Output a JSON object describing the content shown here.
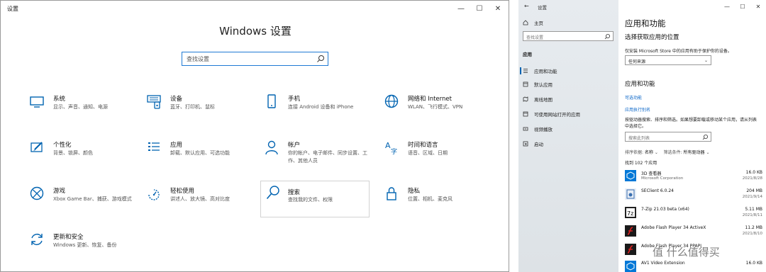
{
  "left": {
    "window_title": "设置",
    "heading": "Windows 设置",
    "search_placeholder": "查找设置",
    "tiles": [
      {
        "title": "系统",
        "desc": "显示、声音、通知、电源"
      },
      {
        "title": "设备",
        "desc": "蓝牙、打印机、鼠标"
      },
      {
        "title": "手机",
        "desc": "连接 Android 设备和 iPhone"
      },
      {
        "title": "网络和 Internet",
        "desc": "WLAN、飞行模式、VPN"
      },
      {
        "title": "个性化",
        "desc": "背景、锁屏、颜色"
      },
      {
        "title": "应用",
        "desc": "卸载、默认应用、可选功能"
      },
      {
        "title": "帐户",
        "desc": "你的帐户、电子邮件、同步设置、工作、其他人员"
      },
      {
        "title": "时间和语言",
        "desc": "语音、区域、日期"
      },
      {
        "title": "游戏",
        "desc": "Xbox Game Bar、捕获、游戏模式"
      },
      {
        "title": "轻松使用",
        "desc": "讲述人、放大镜、高对比度"
      },
      {
        "title": "搜索",
        "desc": "查找我的文件、权限"
      },
      {
        "title": "隐私",
        "desc": "位置、相机、麦克风"
      },
      {
        "title": "更新和安全",
        "desc": "Windows 更新、恢复、备份"
      }
    ],
    "icons": [
      "monitor-icon",
      "keyboard-icon",
      "phone-icon",
      "globe-icon",
      "paintbrush-icon",
      "apps-list-icon",
      "person-icon",
      "language-icon",
      "xbox-icon",
      "ease-of-access-icon",
      "search-icon",
      "lock-icon",
      "refresh-icon"
    ]
  },
  "right": {
    "window_title": "设置",
    "home": "主页",
    "search_placeholder": "查找设置",
    "group": "应用",
    "nav": [
      "应用和功能",
      "默认应用",
      "离线地图",
      "可使用网站打开的应用",
      "视频播放",
      "启动"
    ],
    "title": "应用和功能",
    "section1": "选择获取应用的位置",
    "section1_desc": "仅安装 Microsoft Store 中的应用有助于保护你的设备。",
    "source_value": "任何来源",
    "section2": "应用和功能",
    "link_optional": "可选功能",
    "link_alias": "应用执行别名",
    "para": "按驱动器搜索、排序和筛选。如果想要卸载或移动某个应用，请从列表中选择它。",
    "list_search_placeholder": "搜索此列表",
    "sort_label": "排序依据:",
    "sort_value": "名称",
    "filter_label": "筛选条件:",
    "filter_value": "所有驱动器",
    "found": "找到 102 个应用",
    "apps": [
      {
        "name": "3D 查看器",
        "publisher": "Microsoft Corporation",
        "size": "16.0 KB",
        "date": "2021/8/28"
      },
      {
        "name": "SEClient 6.0.24",
        "publisher": "",
        "size": "204 MB",
        "date": "2021/9/14"
      },
      {
        "name": "7-Zip 21.03 beta (x64)",
        "publisher": "",
        "size": "5.11 MB",
        "date": "2021/8/11"
      },
      {
        "name": "Adobe Flash Player 34 ActiveX",
        "publisher": "",
        "size": "11.2 MB",
        "date": "2021/8/10"
      },
      {
        "name": "Adobe Flash Player 34 PPAPI",
        "publisher": "",
        "size": "",
        "date": ""
      },
      {
        "name": "AV1 Video Extension",
        "publisher": "",
        "size": "16.0 KB",
        "date": ""
      }
    ]
  },
  "watermark": "值 什么值得买",
  "colors": {
    "accent": "#0063b1",
    "link": "#0a66c8",
    "search_border": "#1f7ad4"
  }
}
